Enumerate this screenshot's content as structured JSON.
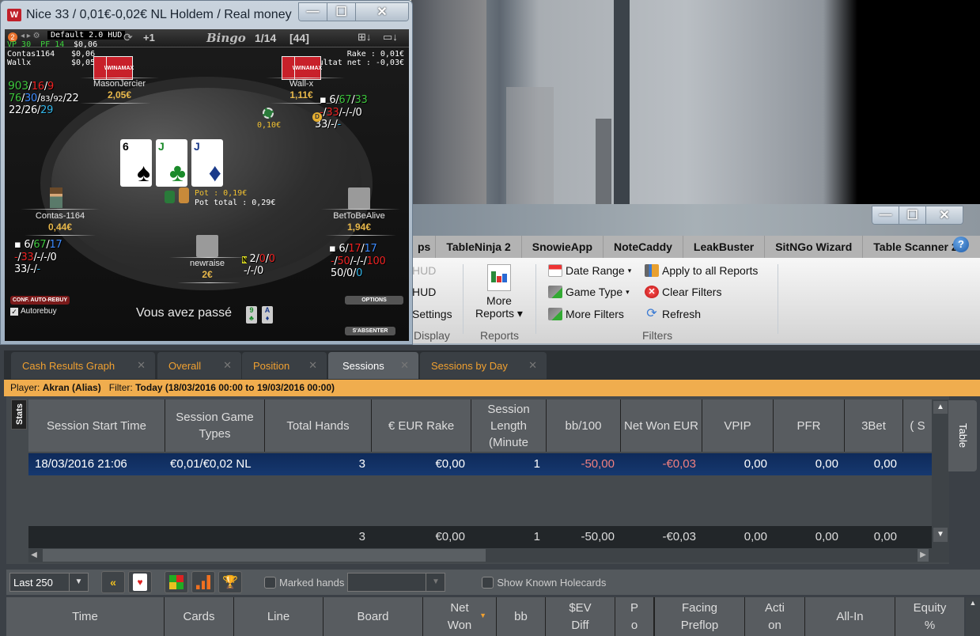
{
  "poker_window": {
    "title": "Nice 33 / 0,01€-0,02€ NL Holdem  / Real money",
    "controls": {
      "minimize": "—",
      "maximize": "☐",
      "close": "✕"
    },
    "toolbar": {
      "hud_badge": "2",
      "hud_profile": "Default 2.0 HUD",
      "plus_one": "+1",
      "bingo_label": "Bingo",
      "hand_counter": "1/14",
      "hands_bracket": "[44]"
    },
    "hud_summary": {
      "vp": "VP 30",
      "pf": "PF 14",
      "amount1": "$0,06",
      "line2_name": "Contas1164",
      "line2_amount": "$0,06",
      "line3_name": "Wallx",
      "line3_amount": "$0,05"
    },
    "rake_info": {
      "rake": "Rake : 0,01€",
      "net_result": "Résultat net : -0,03€"
    },
    "seats": [
      {
        "name": "MasonJercier",
        "stack": "2,05€",
        "stats": [
          [
            "903",
            "16",
            "9"
          ],
          [
            "76",
            "30",
            "83",
            "92",
            "22"
          ],
          [
            "22",
            "26",
            "29"
          ]
        ]
      },
      {
        "name": "Wall-x",
        "stack": "1,11€",
        "stats": [
          [
            "6",
            "67",
            "33"
          ],
          [
            "-",
            "33",
            "-",
            "-",
            "0"
          ],
          [
            "33",
            "-",
            "-"
          ]
        ]
      },
      {
        "name": "Contas-1164",
        "stack": "0,44€",
        "stats": [
          [
            "6",
            "67",
            "17"
          ],
          [
            "-",
            "33",
            "-",
            "-",
            "0"
          ],
          [
            "33",
            "-",
            "-"
          ]
        ]
      },
      {
        "name": "BetToBeAlive",
        "stack": "1,94€",
        "stats": [
          [
            "6",
            "17",
            "17"
          ],
          [
            "-",
            "50",
            "-",
            "-",
            "100"
          ],
          [
            "50",
            "0",
            "0"
          ]
        ]
      },
      {
        "name": "newraise",
        "stack": "2€",
        "stats": [
          [
            "2",
            "0",
            "0"
          ],
          [
            "-",
            "-",
            "0"
          ]
        ]
      }
    ],
    "bet_wallx": "0,10€",
    "board": [
      {
        "rank": "6",
        "suit": "♠",
        "color": "#000"
      },
      {
        "rank": "J",
        "suit": "♣",
        "color": "#1a8a2a"
      },
      {
        "rank": "J",
        "suit": "♦",
        "color": "#1a3a8a"
      }
    ],
    "pot": "Pot : 0,19€",
    "pot_total": "Pot total : 0,29€",
    "auto_rebuy_button": "CONF. AUTO-REBUY",
    "autorebuy_label": "Autorebuy",
    "autorebuy_checked": true,
    "status_message": "Vous avez passé",
    "hole_cards": [
      {
        "rank": "9",
        "suit": "♣",
        "color": "#1a8a2a"
      },
      {
        "rank": "A",
        "suit": "♦",
        "color": "#1a3a8a"
      }
    ],
    "options_button": "OPTIONS",
    "sitout_button": "S'ABSENTER"
  },
  "tracker": {
    "controls": {
      "minimize": "—",
      "maximize": "☐",
      "close": "✕"
    },
    "menu": [
      "ps",
      "TableNinja 2",
      "SnowieApp",
      "NoteCaddy",
      "LeakBuster",
      "SitNGo Wizard",
      "Table Scanner 2"
    ],
    "help": "?",
    "ribbon": {
      "display_items": [
        "HUD",
        "HUD",
        "Settings"
      ],
      "display_group": "Display",
      "more_reports": "More",
      "more_reports2": "Reports",
      "reports_group": "Reports",
      "date_range": "Date Range",
      "game_type": "Game Type",
      "more_filters": "More Filters",
      "apply_all": "Apply to all Reports",
      "clear_filters": "Clear Filters",
      "refresh": "Refresh",
      "filters_group": "Filters"
    },
    "tabs": [
      {
        "label": "Cash Results Graph",
        "active": false
      },
      {
        "label": "Overall",
        "active": false
      },
      {
        "label": "Position",
        "active": false
      },
      {
        "label": "Sessions",
        "active": true
      },
      {
        "label": "Sessions by Day",
        "active": false
      }
    ],
    "tab_close": "✕",
    "filter_bar": {
      "player_label": "Player:",
      "player": "Akran (Alias)",
      "filter_label": "Filter:",
      "filter": "Today (18/03/2016 00:00 to 19/03/2016 00:00)"
    },
    "stats_tab": "Stats",
    "table_tab": "Table",
    "sessions_table": {
      "columns": [
        "Session Start Time",
        "Session Game Types",
        "Total Hands",
        "€ EUR Rake",
        "Session Length (Minute",
        "bb/100",
        "Net Won EUR",
        "VPIP",
        "PFR",
        "3Bet",
        "( S"
      ],
      "rows": [
        [
          "18/03/2016 21:06",
          "€0,01/€0,02 NL",
          "3",
          "€0,00",
          "1",
          "-50,00",
          "-€0,03",
          "0,00",
          "0,00",
          "0,00"
        ]
      ],
      "totals": [
        "",
        "",
        "3",
        "€0,00",
        "1",
        "-50,00",
        "-€0,03",
        "0,00",
        "0,00",
        "0,00"
      ]
    },
    "hands_toolbar": {
      "range_select": "Last 250",
      "marked_hands_label": "Marked hands",
      "marked_hands_value": "",
      "show_holecards_label": "Show Known Holecards"
    },
    "hands_table": {
      "columns": [
        "Time",
        "Cards",
        "Line",
        "Board",
        "Net Won",
        "bb",
        "$EV Diff",
        "P o",
        "Facing Preflop",
        "Acti on",
        "All-In",
        "Equity %"
      ]
    }
  }
}
